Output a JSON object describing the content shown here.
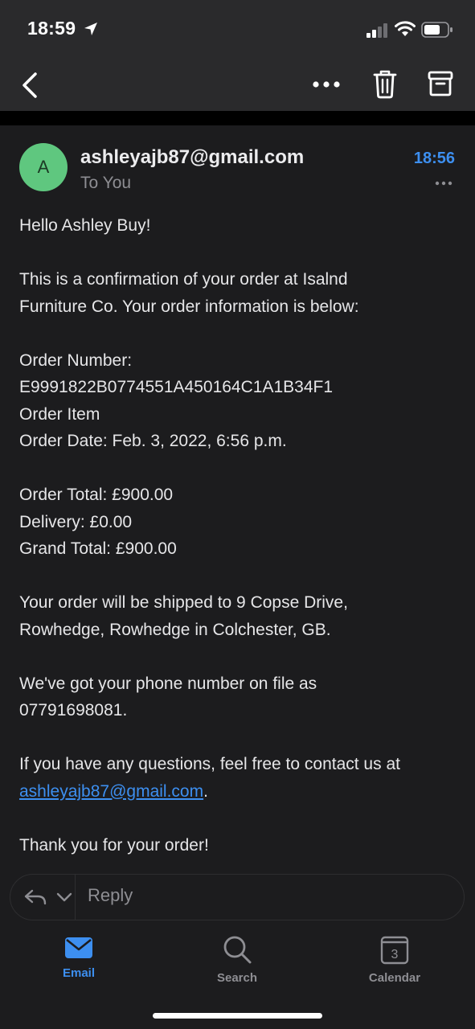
{
  "status_bar": {
    "time": "18:59"
  },
  "toolbar": {
    "back_icon": "chevron-left-icon",
    "more_icon": "ellipsis-icon",
    "delete_icon": "trash-icon",
    "archive_icon": "archive-box-icon"
  },
  "message": {
    "avatar_initial": "A",
    "avatar_color": "#5fc77f",
    "sender": "ashleyajb87@gmail.com",
    "recipient": "To You",
    "time": "18:56",
    "accent_color": "#3d8ff0",
    "body": {
      "greeting": "Hello Ashley Buy!",
      "intro_line1": "This is a confirmation of your order at Isalnd",
      "intro_line2": "Furniture Co. Your order information is below:",
      "order_number_label": "Order Number:",
      "order_number": "E9991822B0774551A450164C1A1B34F1",
      "order_item": "Order Item",
      "order_date": "Order Date: Feb. 3, 2022, 6:56 p.m.",
      "order_total": "Order Total: £900.00",
      "delivery": "Delivery: £0.00",
      "grand_total": "Grand Total: £900.00",
      "shipping_line1": "Your order will be shipped to 9 Copse Drive,",
      "shipping_line2": "Rowhedge, Rowhedge in Colchester, GB.",
      "phone_line1": "We've got your phone number on file as",
      "phone_line2": "07791698081.",
      "questions_line": "If you have any questions, feel free to contact us at",
      "contact_email": "ashleyajb87@gmail.com",
      "contact_suffix": ".",
      "thanks": "Thank you for your order!"
    }
  },
  "reply_bar": {
    "placeholder": "Reply"
  },
  "tab_bar": {
    "tabs": [
      {
        "label": "Email",
        "icon": "envelope-icon",
        "active": true
      },
      {
        "label": "Search",
        "icon": "magnifier-icon",
        "active": false
      },
      {
        "label": "Calendar",
        "icon": "calendar-icon",
        "active": false
      }
    ],
    "calendar_day": "3"
  }
}
